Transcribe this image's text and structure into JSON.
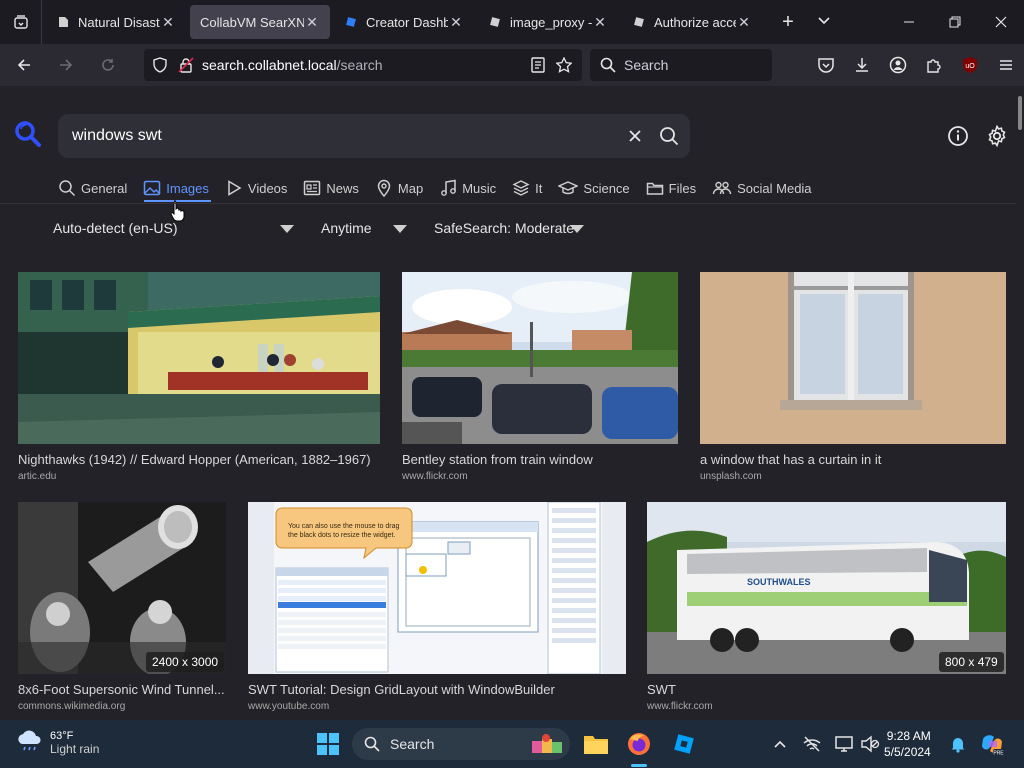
{
  "browser": {
    "tabs": [
      {
        "title": "Natural Disaster",
        "active": false
      },
      {
        "title": "CollabVM SearXNG",
        "active": true
      },
      {
        "title": "Creator Dashbo",
        "active": false
      },
      {
        "title": "image_proxy - R",
        "active": false
      },
      {
        "title": "Authorize acces",
        "active": false
      }
    ],
    "url_host": "search.collabnet.local",
    "url_path": "/search",
    "search_placeholder": "Search"
  },
  "search": {
    "query": "windows swt",
    "categories": [
      {
        "label": "General",
        "icon": "search-icon",
        "active": false
      },
      {
        "label": "Images",
        "icon": "image-icon",
        "active": true
      },
      {
        "label": "Videos",
        "icon": "play-icon",
        "active": false
      },
      {
        "label": "News",
        "icon": "newspaper-icon",
        "active": false
      },
      {
        "label": "Map",
        "icon": "map-pin-icon",
        "active": false
      },
      {
        "label": "Music",
        "icon": "music-icon",
        "active": false
      },
      {
        "label": "It",
        "icon": "layers-icon",
        "active": false
      },
      {
        "label": "Science",
        "icon": "graduation-cap-icon",
        "active": false
      },
      {
        "label": "Files",
        "icon": "folder-icon",
        "active": false
      },
      {
        "label": "Social Media",
        "icon": "people-icon",
        "active": false
      }
    ],
    "filters": {
      "language": "Auto-detect (en-US)",
      "time": "Anytime",
      "safesearch": "SafeSearch: Moderate"
    }
  },
  "results": [
    {
      "title": "Nighthawks (1942) // Edward Hopper (American, 1882–1967)",
      "source": "artic.edu",
      "dims": ""
    },
    {
      "title": "Bentley station from train window",
      "source": "www.flickr.com",
      "dims": ""
    },
    {
      "title": "a window that has a curtain in it",
      "source": "unsplash.com",
      "dims": ""
    },
    {
      "title": "8x6-Foot Supersonic Wind Tunnel...",
      "source": "commons.wikimedia.org",
      "dims": "2400 x 3000"
    },
    {
      "title": "SWT Tutorial: Design GridLayout with WindowBuilder",
      "source": "www.youtube.com",
      "dims": ""
    },
    {
      "title": "SWT",
      "source": "www.flickr.com",
      "dims": "800 x 479"
    }
  ],
  "tutorial_callout": "You can also use the mouse to drag the black dots to resize the widget.",
  "bus_text": "SOUTHWALES",
  "taskbar": {
    "weather_temp": "63°F",
    "weather_desc": "Light rain",
    "search_label": "Search",
    "time": "9:28 AM",
    "date": "5/5/2024"
  }
}
